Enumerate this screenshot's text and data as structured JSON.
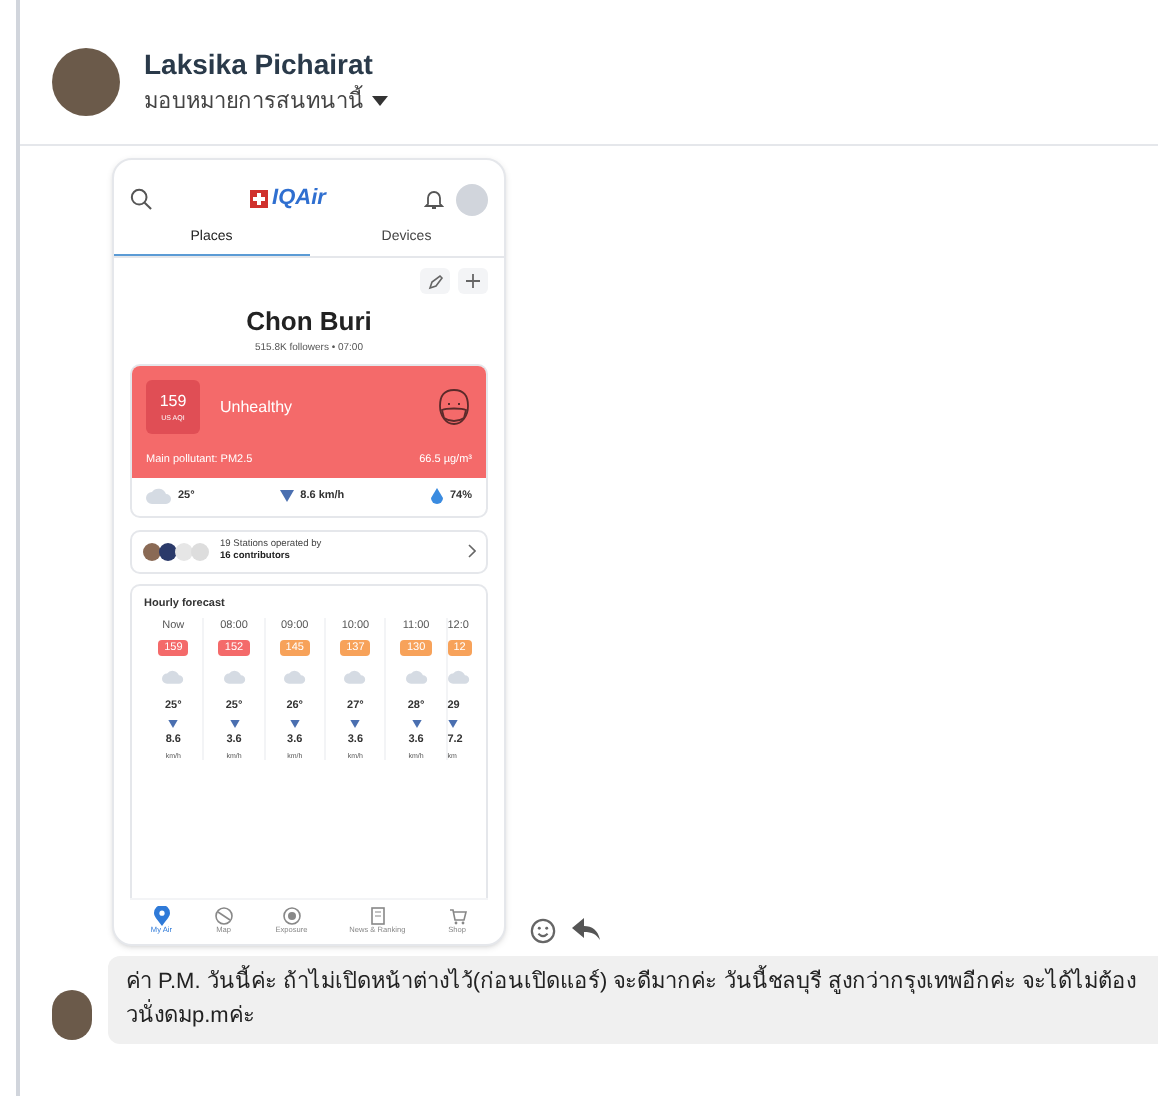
{
  "header": {
    "name": "Laksika Pichairat",
    "assign_label": "มอบหมายการสนทนานี้"
  },
  "app": {
    "logo": "IQAir",
    "tabs": [
      {
        "label": "Places",
        "selected": true
      },
      {
        "label": "Devices",
        "selected": false
      }
    ],
    "city": "Chon Buri",
    "subtitle": "515.8K followers • 07:00",
    "aqi": {
      "value": "159",
      "unit": "US AQI",
      "status": "Unhealthy",
      "pollutant": "Main pollutant: PM2.5",
      "concentration": "66.5 µg/m³"
    },
    "weather": {
      "temperature": "25°",
      "wind": "8.6 km/h",
      "humidity": "74%"
    },
    "stations": {
      "line_1": "19 Stations operated by",
      "line_2": "16 contributors"
    },
    "forecast_title": "Hourly forecast",
    "forecast": [
      {
        "time": "Now",
        "aqi": "159",
        "color": "#f46a6a",
        "temp": "25°",
        "wind": "8.6",
        "unit": "km/h"
      },
      {
        "time": "08:00",
        "aqi": "152",
        "color": "#f46a6a",
        "temp": "25°",
        "wind": "3.6",
        "unit": "km/h"
      },
      {
        "time": "09:00",
        "aqi": "145",
        "color": "#f7a25a",
        "temp": "26°",
        "wind": "3.6",
        "unit": "km/h"
      },
      {
        "time": "10:00",
        "aqi": "137",
        "color": "#f7a25a",
        "temp": "27°",
        "wind": "3.6",
        "unit": "km/h"
      },
      {
        "time": "11:00",
        "aqi": "130",
        "color": "#f7a25a",
        "temp": "28°",
        "wind": "3.6",
        "unit": "km/h"
      },
      {
        "time": "12:0",
        "aqi": "12",
        "color": "#f7a25a",
        "temp": "29",
        "wind": "7.2",
        "unit": "km"
      }
    ],
    "nav": [
      {
        "label": "My Air",
        "selected": true
      },
      {
        "label": "Map",
        "selected": false
      },
      {
        "label": "Exposure",
        "selected": false
      },
      {
        "label": "News & Ranking",
        "selected": false
      },
      {
        "label": "Shop",
        "selected": false
      }
    ]
  },
  "message": "ค่า P.M. วันนี้ค่ะ ถ้าไม่เปิดหน้าต่างไว้(ก่อนเปิดแอร์) จะดีมากค่ะ วันนี้ชลบุรี สูงกว่ากรุงเทพอีกค่ะ จะได้ไม่ต้องวนั่งดมp.mค่ะ"
}
